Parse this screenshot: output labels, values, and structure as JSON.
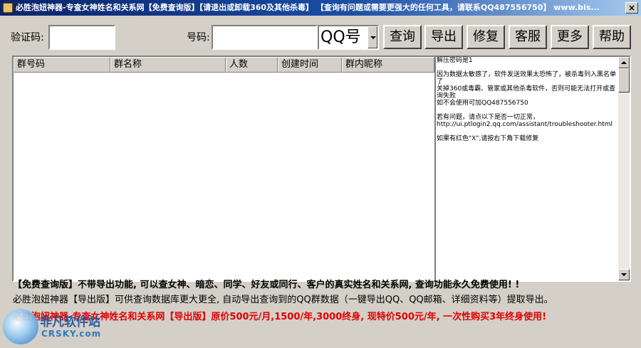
{
  "window": {
    "title": "必胜泡妞神器-专查女神姓名和关系网【免费查询版】【请退出或卸载360及其他杀毒】 【查询有问题或需要更强大的任何工具，请联系QQ487556750】 www.bis...",
    "close_label": "×"
  },
  "form": {
    "captcha_label": "验证码:",
    "captcha_value": "",
    "number_label": "号码:",
    "number_value": "",
    "type_selected": "QQ号"
  },
  "toolbar": {
    "query": "查询",
    "export": "导出",
    "repair": "修复",
    "service": "客服",
    "more": "更多",
    "help": "帮助"
  },
  "table": {
    "columns": [
      "群号码",
      "群名称",
      "人数",
      "创建时间",
      "群内昵称"
    ],
    "rows": []
  },
  "info": {
    "lines": [
      "解压密码是1",
      "因为数据太敏感了，软件发送效果太恐怖了，被杀毒列入黑名单了",
      "关掉360或毒霸、管家或其他杀毒软件，否则可能无法打开或查询失败",
      "如不会使用可加QQ487556750",
      "若有问题，请点以下是否一切正常，",
      "http://ui.ptlogin2.qq.com/assistant/troubleshooter.html",
      "如果有红色\"X\",请按右下角下载修复"
    ]
  },
  "notes": {
    "line1": "【免费查询版】不带导出功能, 可以查女神、暗恋、同学、好友或同行、客户的真实姓名和关系网, 查询功能永久免费使用! !",
    "line2": "必胜泡妞神器【导出版】可供查询数据库更大更全, 自动导出查询到的QQ群数据（一键导出QQ、QQ邮箱、详细资料等）提取导出。",
    "line3": "必胜泡妞神器-专查女神姓名和关系网【导出版】原价500元/月,1500/年,3000终身, 现特价500元/年, 一次性购买3年终身使用!"
  },
  "watermark": {
    "main": "非凡软件站",
    "sub": "CRSKY.com"
  }
}
